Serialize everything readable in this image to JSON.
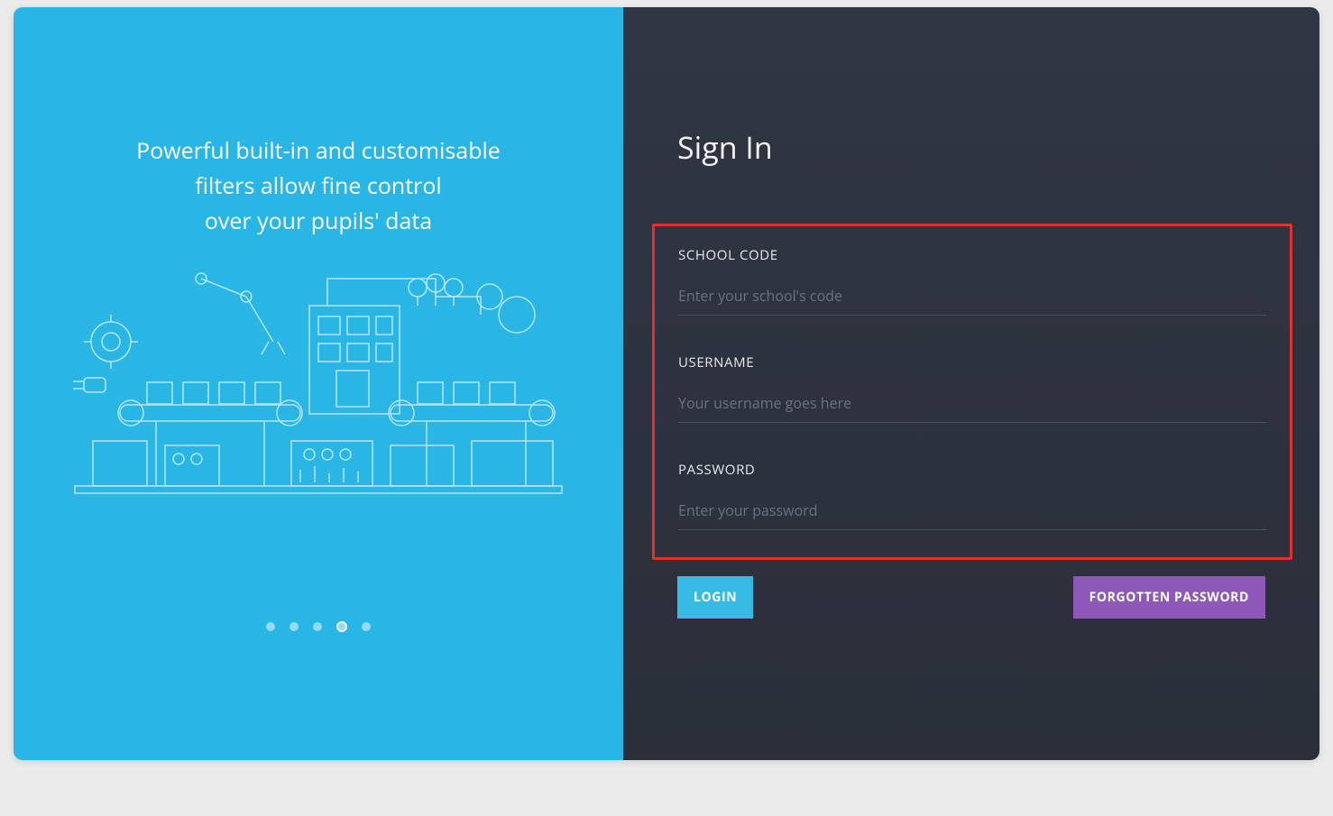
{
  "promo": {
    "line1": "Powerful built-in and customisable",
    "line2": "filters allow fine control",
    "line3": "over your pupils' data"
  },
  "carousel": {
    "total_dots": 5,
    "active_index": 3
  },
  "signin": {
    "title": "Sign In",
    "fields": {
      "school_code": {
        "label": "SCHOOL CODE",
        "placeholder": "Enter your school's code"
      },
      "username": {
        "label": "USERNAME",
        "placeholder": "Your username goes here"
      },
      "password": {
        "label": "PASSWORD",
        "placeholder": "Enter your password"
      }
    },
    "buttons": {
      "login": "LOGIN",
      "forgot": "FORGOTTEN PASSWORD"
    }
  },
  "colors": {
    "left_panel_bg": "#29b6e5",
    "right_panel_bg": "#2b303b",
    "highlight_border": "#e03131",
    "login_btn": "#37bbe4",
    "forgot_btn": "#8d58b7"
  }
}
